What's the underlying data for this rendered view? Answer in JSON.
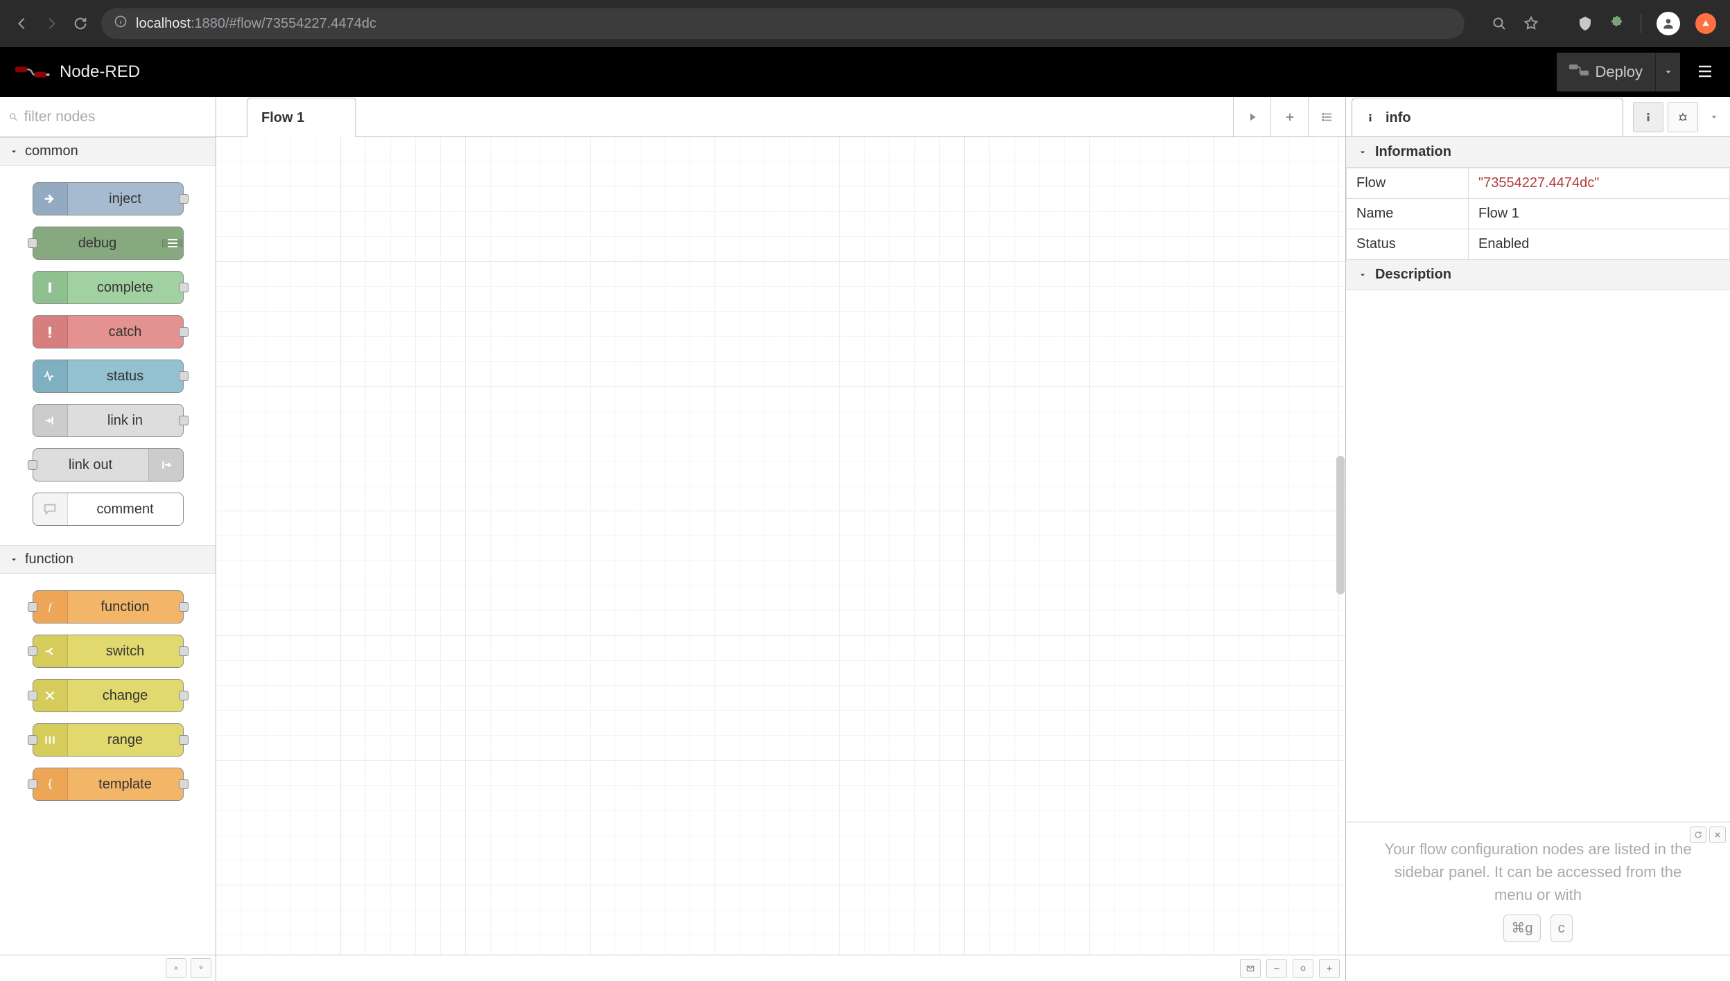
{
  "browser": {
    "url_host": "localhost",
    "url_port_path": ":1880/#flow/73554227.4474dc"
  },
  "header": {
    "brand": "Node-RED",
    "deploy_label": "Deploy"
  },
  "palette": {
    "search_placeholder": "filter nodes",
    "categories": {
      "common": {
        "label": "common",
        "nodes": {
          "inject": "inject",
          "debug": "debug",
          "complete": "complete",
          "catch": "catch",
          "status": "status",
          "link_in": "link in",
          "link_out": "link out",
          "comment": "comment"
        }
      },
      "function": {
        "label": "function",
        "nodes": {
          "function": "function",
          "switch": "switch",
          "change": "change",
          "range": "range",
          "template": "template"
        }
      }
    }
  },
  "workspace": {
    "tabs": {
      "0": {
        "label": "Flow 1"
      }
    }
  },
  "sidebar": {
    "tab_label": "info",
    "sections": {
      "information": "Information",
      "description": "Description"
    },
    "info": {
      "flow_key": "Flow",
      "flow_val": "\"73554227.4474dc\"",
      "name_key": "Name",
      "name_val": "Flow 1",
      "status_key": "Status",
      "status_val": "Enabled"
    },
    "tip_text_a": "Your flow configuration nodes are listed in the sidebar panel. It can be accessed from the menu or with",
    "key1": "⌘g",
    "key2": "c"
  }
}
